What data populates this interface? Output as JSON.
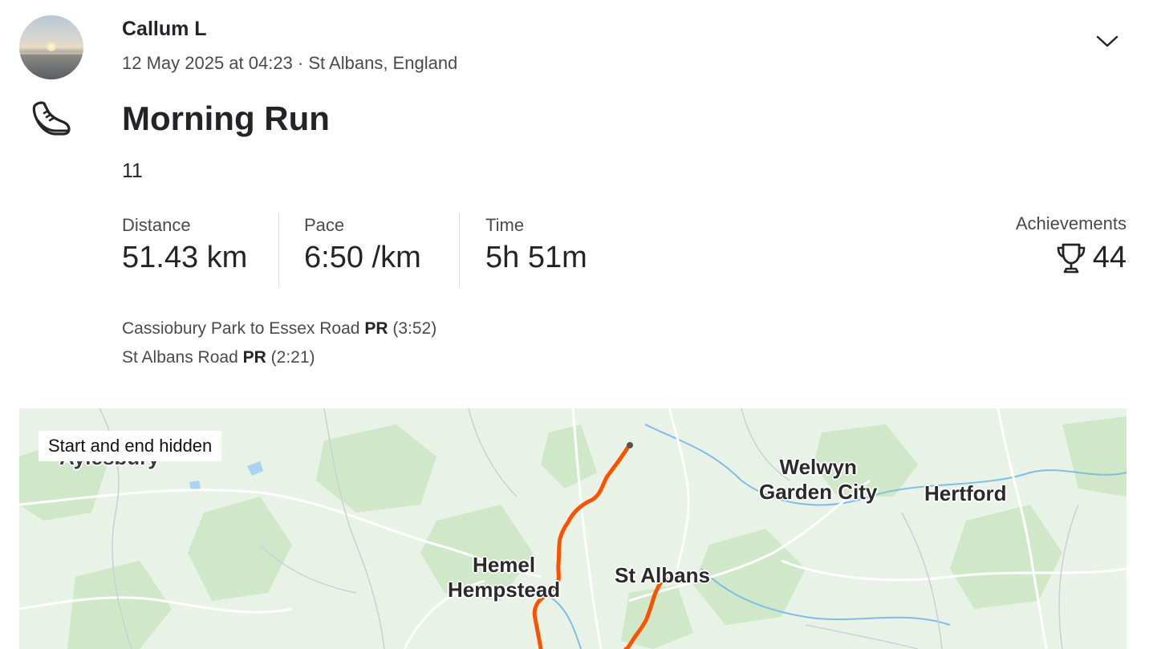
{
  "athlete": {
    "name": "Callum L"
  },
  "activity": {
    "meta": "12 May 2025 at 04:23 · St Albans, England",
    "title": "Morning Run",
    "description": "11",
    "sport_icon": "running-shoe-icon",
    "menu_icon": "chevron-down-icon"
  },
  "stats": [
    {
      "label": "Distance",
      "value": "51.43 km"
    },
    {
      "label": "Pace",
      "value": "6:50 /km"
    },
    {
      "label": "Time",
      "value": "5h 51m"
    }
  ],
  "achievements": {
    "label": "Achievements",
    "count": "44",
    "icon": "trophy-icon"
  },
  "segments": [
    {
      "name": "Cassiobury Park to Essex Road",
      "badge": "PR",
      "time": "(3:52)"
    },
    {
      "name": "St Albans Road",
      "badge": "PR",
      "time": "(2:21)"
    }
  ],
  "map": {
    "badge": "Start and end hidden",
    "towns": {
      "aylesbury": "Aylesbury",
      "welwyn_line1": "Welwyn",
      "welwyn_line2": "Garden City",
      "hertford": "Hertford",
      "hemel_line1": "Hemel",
      "hemel_line2": "Hempstead",
      "st_albans": "St Albans"
    },
    "route_color": "#fc5200"
  }
}
